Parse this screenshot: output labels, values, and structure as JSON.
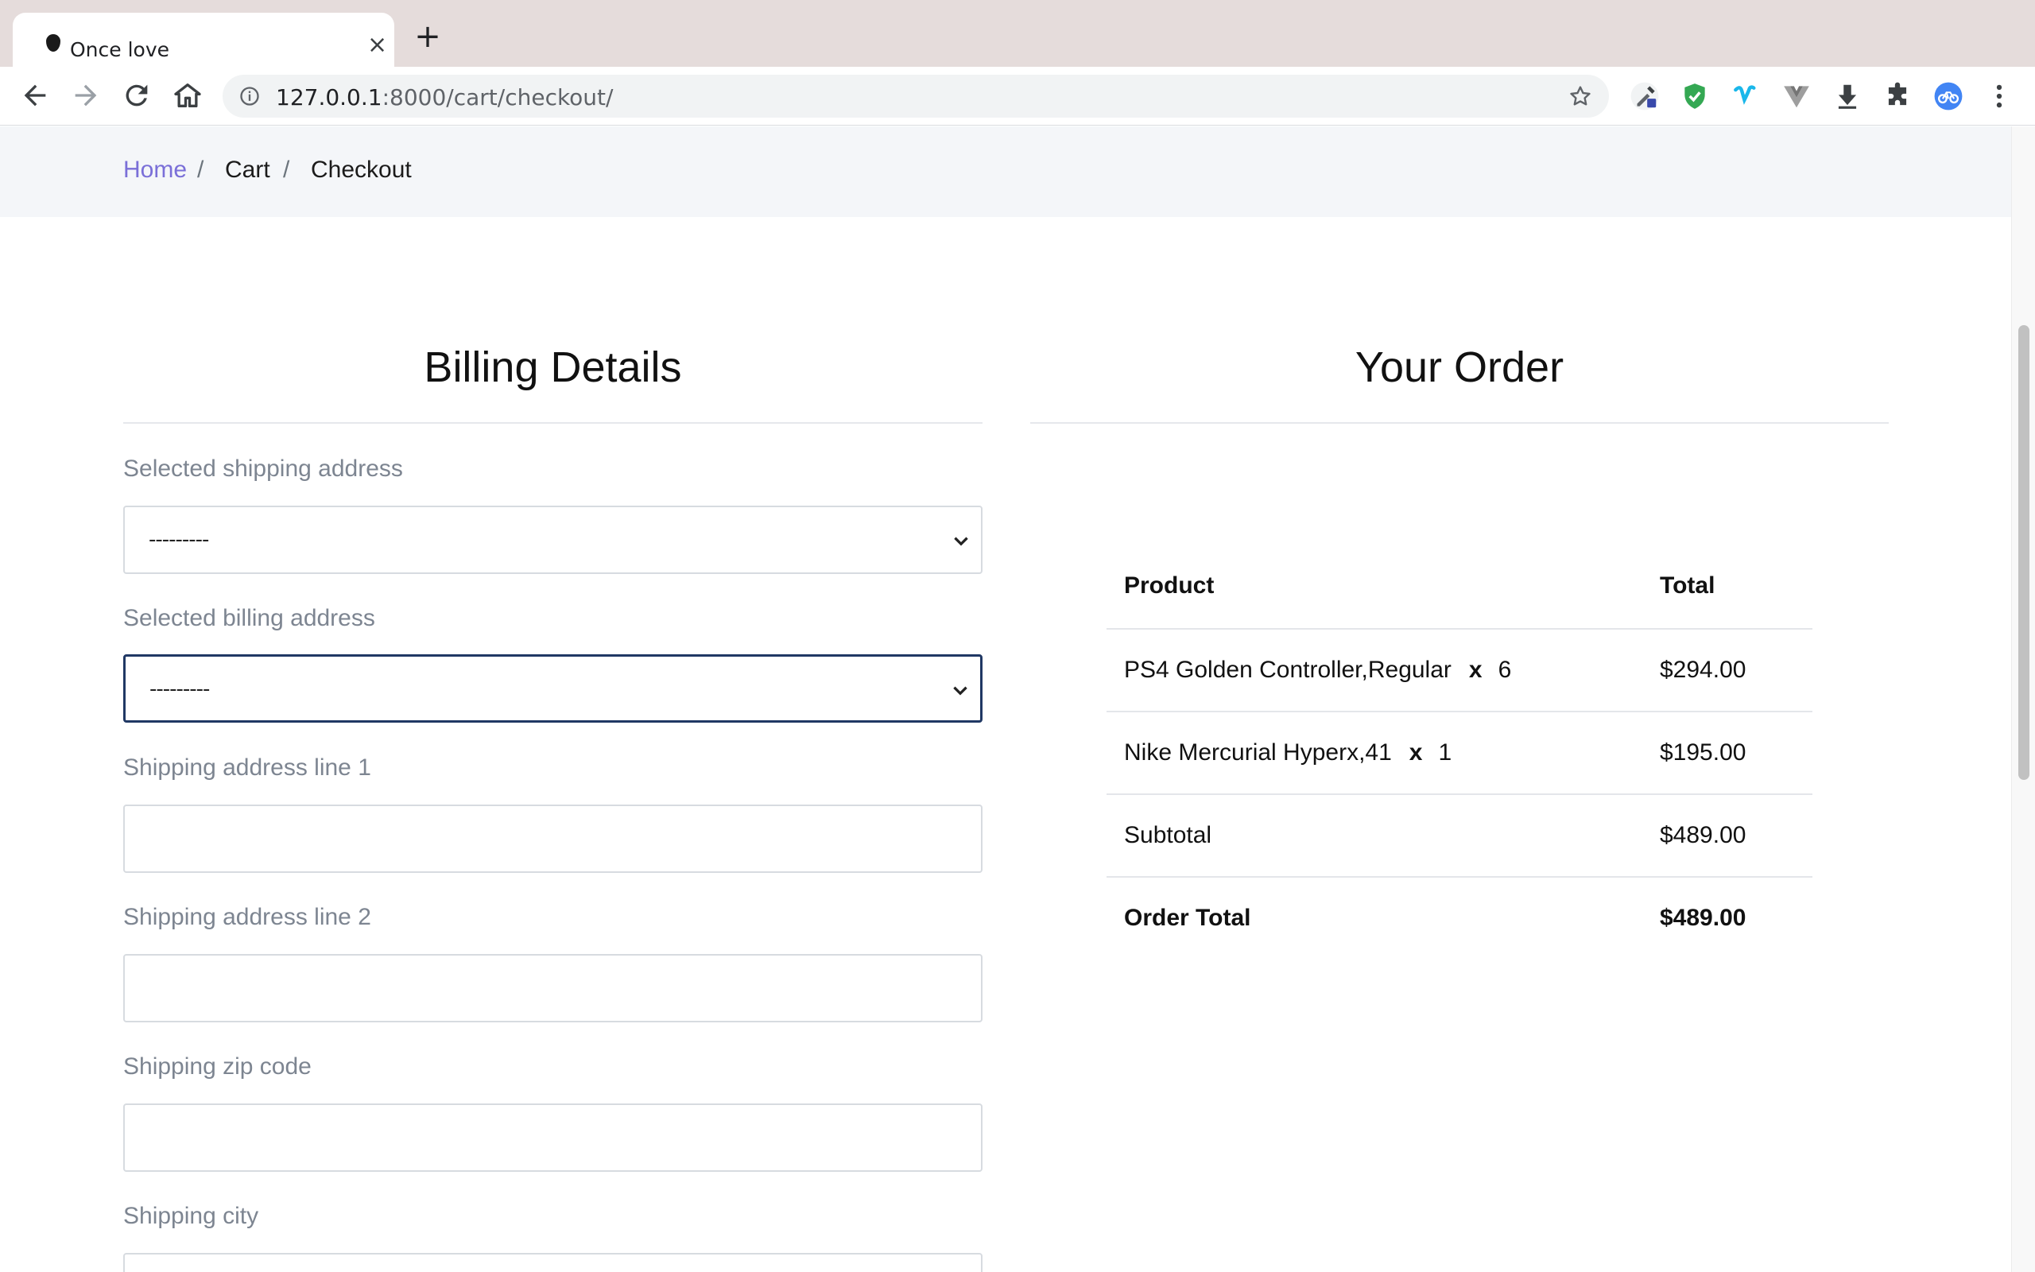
{
  "browser": {
    "tab_title": "Once love",
    "url_host": "127.0.0.1",
    "url_rest": ":8000/cart/checkout/"
  },
  "breadcrumb": {
    "home": "Home",
    "cart": "Cart",
    "current": "Checkout",
    "separator": "/"
  },
  "billing": {
    "title": "Billing Details",
    "shipping_address_label": "Selected shipping address",
    "shipping_address_value": "---------",
    "billing_address_label": "Selected billing address",
    "billing_address_value": "---------",
    "line1_label": "Shipping address line 1",
    "line2_label": "Shipping address line 2",
    "zip_label": "Shipping zip code",
    "city_label": "Shipping city"
  },
  "order": {
    "title": "Your Order",
    "col_product": "Product",
    "col_total": "Total",
    "items": [
      {
        "name": "PS4 Golden Controller,Regular",
        "x": "x",
        "qty": "6",
        "total": "$294.00"
      },
      {
        "name": "Nike Mercurial Hyperx,41",
        "x": "x",
        "qty": "1",
        "total": "$195.00"
      }
    ],
    "subtotal_label": "Subtotal",
    "subtotal_value": "$489.00",
    "order_total_label": "Order Total",
    "order_total_value": "$489.00"
  },
  "colors": {
    "link": "#7a6fd8",
    "focus_border": "#203864",
    "breadcrumb_bg": "#f4f6f9"
  }
}
